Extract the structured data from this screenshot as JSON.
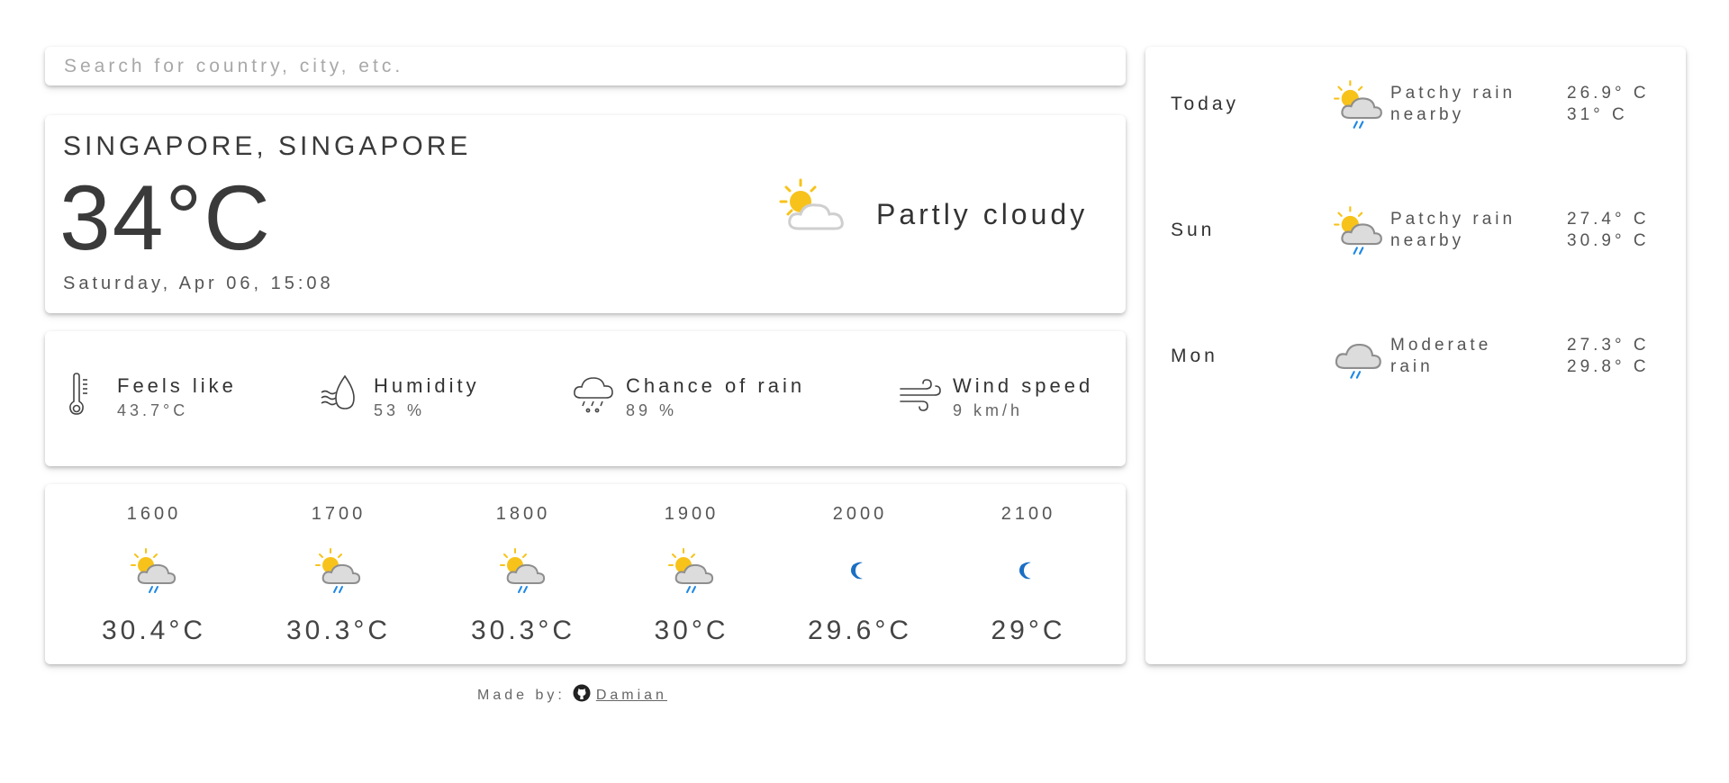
{
  "search": {
    "placeholder": "Search for country, city, etc."
  },
  "current": {
    "location": "SINGAPORE, SINGAPORE",
    "temperature": "34°C",
    "datetime": "Saturday, Apr 06, 15:08",
    "condition": "Partly cloudy",
    "condition_icon": "partly-cloudy-icon"
  },
  "details": [
    {
      "label": "Feels like",
      "value": "43.7°C",
      "icon": "thermometer-icon"
    },
    {
      "label": "Humidity",
      "value": "53 %",
      "icon": "humidity-icon"
    },
    {
      "label": "Chance of rain",
      "value": "89 %",
      "icon": "rain-cloud-icon"
    },
    {
      "label": "Wind speed",
      "value": "9 km/h",
      "icon": "wind-icon"
    }
  ],
  "hourly": [
    {
      "time": "1600",
      "temp": "30.4°C",
      "icon": "patchy-rain-day-icon"
    },
    {
      "time": "1700",
      "temp": "30.3°C",
      "icon": "patchy-rain-day-icon"
    },
    {
      "time": "1800",
      "temp": "30.3°C",
      "icon": "patchy-rain-day-icon"
    },
    {
      "time": "1900",
      "temp": "30°C",
      "icon": "patchy-rain-day-icon"
    },
    {
      "time": "2000",
      "temp": "29.6°C",
      "icon": "moon-icon"
    },
    {
      "time": "2100",
      "temp": "29°C",
      "icon": "moon-icon"
    }
  ],
  "forecast": [
    {
      "day": "Today",
      "condition_line1": "Patchy rain",
      "condition_line2": "nearby",
      "low": "26.9° C",
      "high": "31° C",
      "icon": "patchy-rain-day-icon"
    },
    {
      "day": "Sun",
      "condition_line1": "Patchy rain",
      "condition_line2": "nearby",
      "low": "27.4° C",
      "high": "30.9° C",
      "icon": "patchy-rain-day-icon"
    },
    {
      "day": "Mon",
      "condition_line1": "Moderate",
      "condition_line2": "rain",
      "low": "27.3° C",
      "high": "29.8° C",
      "icon": "moderate-rain-icon"
    }
  ],
  "footer": {
    "prefix": "Made by:",
    "author": " Damian",
    "icon": "github-icon"
  },
  "colors": {
    "sun": "#f7c31b",
    "cloud": "#9e9e9e",
    "rain": "#1e88e5",
    "moon": "#1a6fc4",
    "text": "#3a3a3a"
  }
}
